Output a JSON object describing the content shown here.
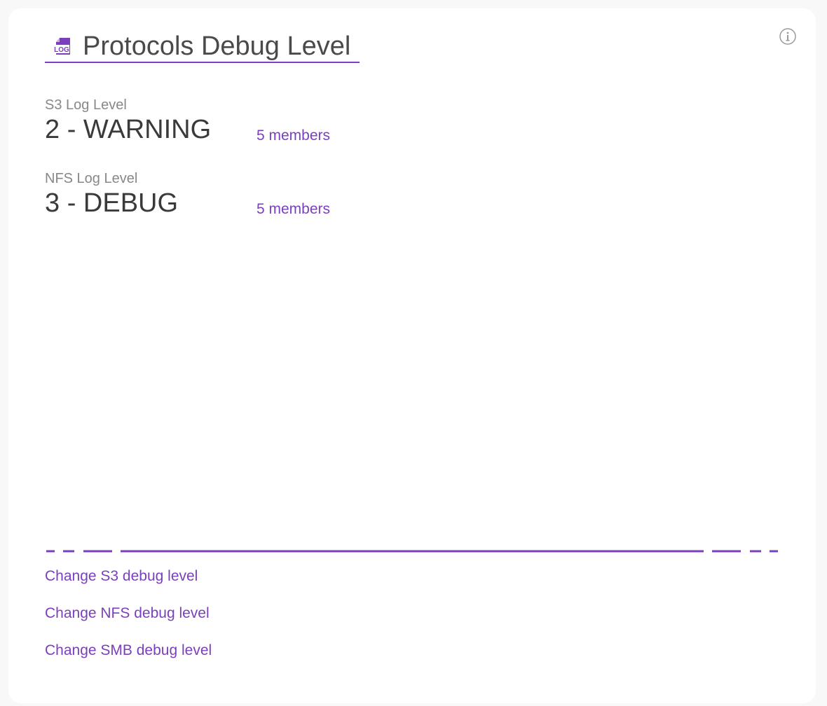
{
  "header": {
    "title": "Protocols Debug Level",
    "icon": "log-file-icon",
    "info_icon": "info-icon"
  },
  "levels": [
    {
      "label": "S3 Log Level",
      "value": "2 - WARNING",
      "members": "5 members"
    },
    {
      "label": "NFS Log Level",
      "value": "3 - DEBUG",
      "members": "5 members"
    }
  ],
  "actions": [
    {
      "label": "Change S3 debug level"
    },
    {
      "label": "Change NFS debug level"
    },
    {
      "label": "Change SMB debug level"
    }
  ],
  "colors": {
    "accent": "#7b3fbe",
    "label_gray": "#888888",
    "value_dark": "#3a3a3a",
    "title_gray": "#4a4a4a"
  }
}
